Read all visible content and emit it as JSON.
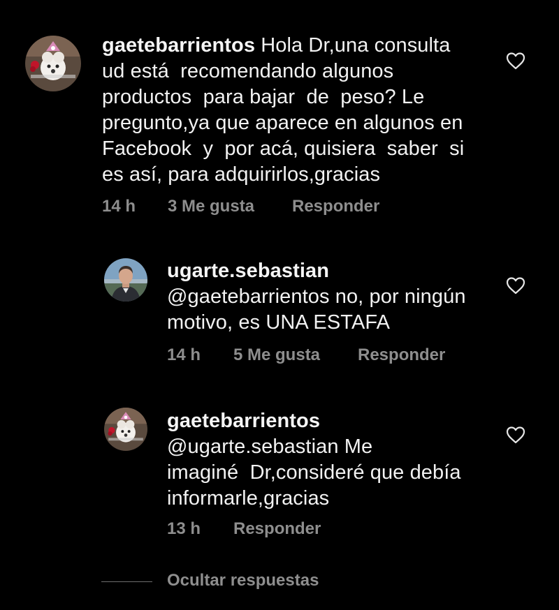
{
  "comments": [
    {
      "username": "gaetebarrientos",
      "text_lines": [
        " Hola Dr,una consulta",
        "ud está  recomendando algunos",
        "productos  para bajar  de  peso? Le",
        "pregunto,ya que aparece en algunos en",
        "Facebook  y  por acá, quisiera  saber  si",
        "es así, para adquirirlos,gracias"
      ],
      "time": "14 h",
      "likes": "3 Me gusta",
      "reply_label": "Responder",
      "avatar_icon": "dog-avatar-icon",
      "heart_icon": "heart-outline-icon"
    },
    {
      "username": "ugarte.sebastian",
      "text_lines": [
        "@gaetebarrientos no, por ningún",
        "motivo, es UNA ESTAFA"
      ],
      "time": "14 h",
      "likes": "5 Me gusta",
      "reply_label": "Responder",
      "avatar_icon": "man-portrait-avatar-icon",
      "heart_icon": "heart-outline-icon"
    },
    {
      "username": "gaetebarrientos",
      "text_lines": [
        "@ugarte.sebastian Me",
        "imaginé  Dr,consideré que debía",
        "informarle,gracias"
      ],
      "time": "13 h",
      "likes": "",
      "reply_label": "Responder",
      "avatar_icon": "dog-avatar-icon",
      "heart_icon": "heart-outline-icon"
    }
  ],
  "hide_replies_label": "Ocultar respuestas",
  "colors": {
    "background": "#000000",
    "text": "#f2f2f2",
    "secondary": "#8e8e8e"
  }
}
